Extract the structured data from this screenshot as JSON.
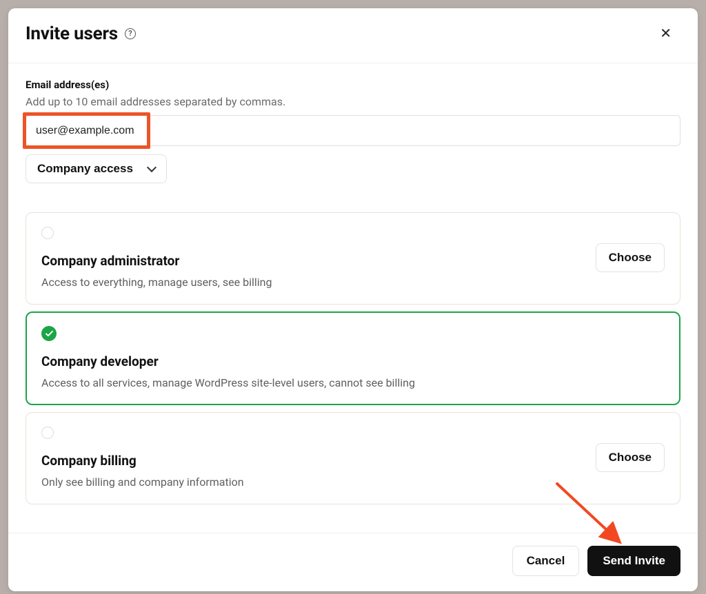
{
  "header": {
    "title": "Invite users"
  },
  "email": {
    "label": "Email address(es)",
    "hint": "Add up to 10 email addresses separated by commas.",
    "value": "user@example.com"
  },
  "access_dropdown": {
    "label": "Company access"
  },
  "roles": [
    {
      "title": "Company administrator",
      "description": "Access to everything, manage users, see billing",
      "selected": false,
      "choose_label": "Choose"
    },
    {
      "title": "Company developer",
      "description": "Access to all services, manage WordPress site-level users, cannot see billing",
      "selected": true
    },
    {
      "title": "Company billing",
      "description": "Only see billing and company information",
      "selected": false,
      "choose_label": "Choose"
    }
  ],
  "footer": {
    "cancel": "Cancel",
    "submit": "Send Invite"
  },
  "annotations": {
    "email_highlight_color": "#EC5428",
    "arrow_color": "#F24822"
  }
}
